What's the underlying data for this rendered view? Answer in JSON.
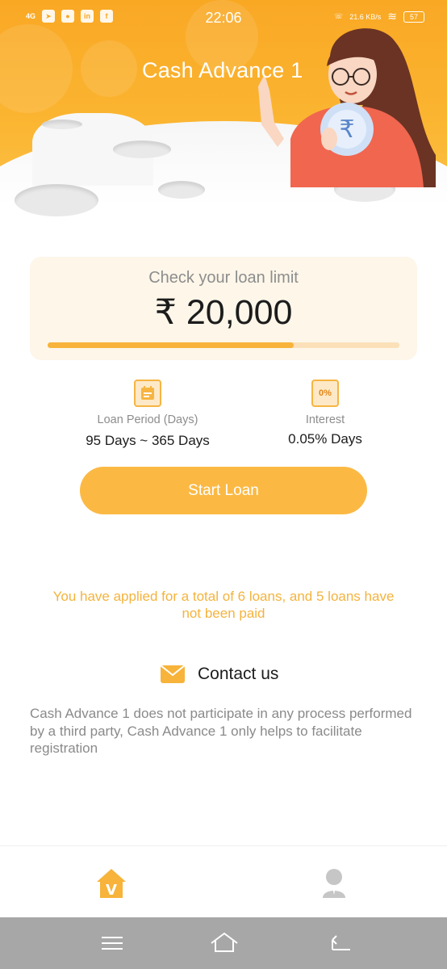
{
  "status_bar": {
    "time": "22:06",
    "network": "4G",
    "speed": "21.6",
    "speed_unit": "KB/s",
    "battery": "57"
  },
  "header": {
    "title": "Cash Advance 1"
  },
  "loan_card": {
    "heading": "Check your loan limit",
    "amount": "₹ 20,000",
    "progress_fraction": 0.7
  },
  "info": {
    "period_label": "Loan Period (Days)",
    "period_value": "95 Days ~ 365 Days",
    "interest_label": "Interest",
    "interest_value": "0.05% Days",
    "interest_icon_text": "0%"
  },
  "start_button": {
    "label": "Start Loan"
  },
  "notice": "You have applied for a total of 6 loans, and 5 loans have not been paid",
  "contact": {
    "label": "Contact us"
  },
  "disclaimer": "Cash Advance 1 does not participate in any process performed by a third party, Cash Advance 1 only helps to facilitate registration",
  "tabs": [
    {
      "name": "home",
      "icon": "home-icon",
      "active": true,
      "icon_letter": "V"
    },
    {
      "name": "profile",
      "icon": "user-icon",
      "active": false
    }
  ],
  "colors": {
    "accent": "#f9a824",
    "button": "#fbb944",
    "notice": "#f4b33d"
  }
}
